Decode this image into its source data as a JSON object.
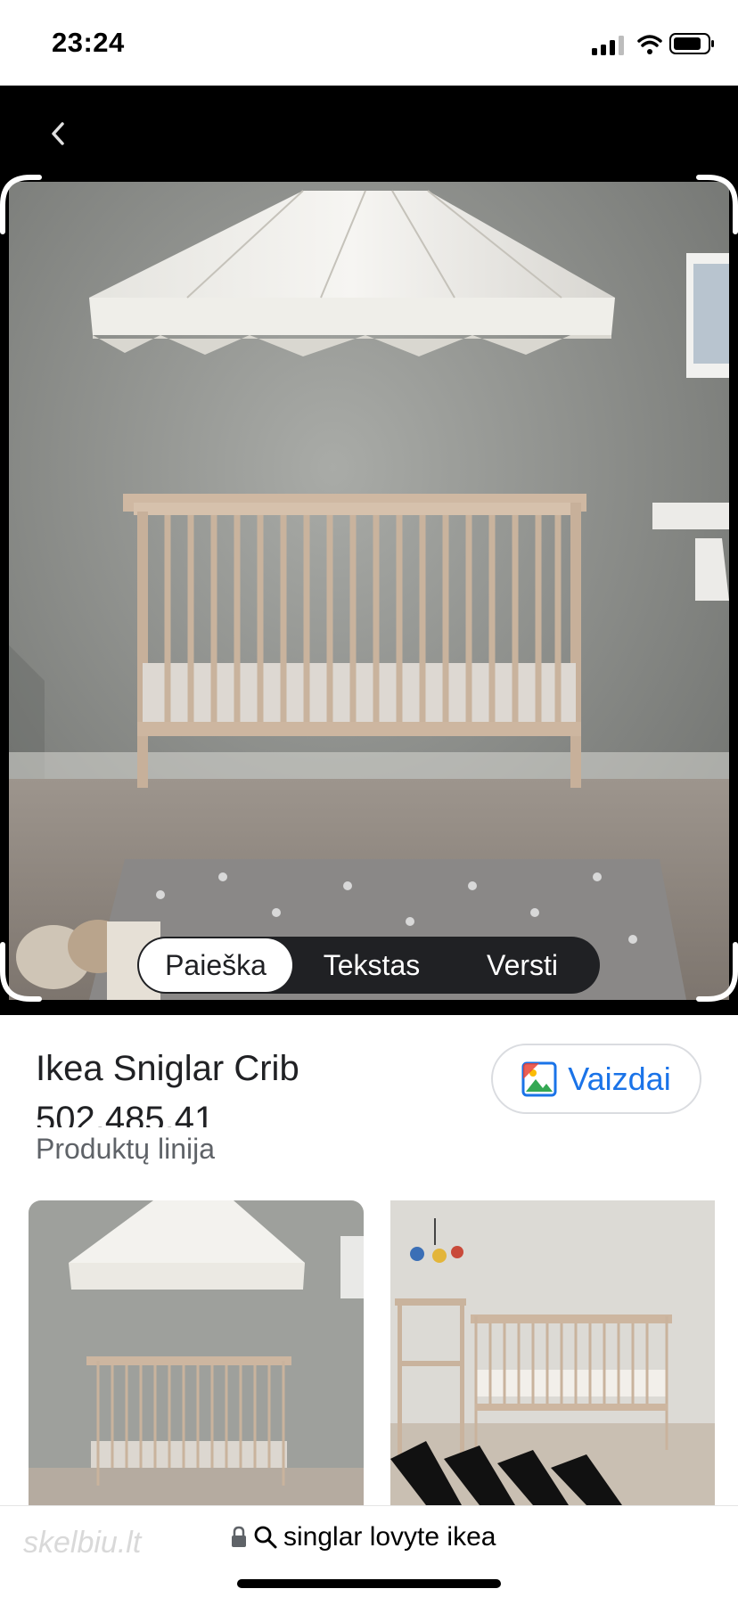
{
  "status_bar": {
    "time": "23:24",
    "icons": [
      "cellular-signal-icon",
      "wifi-icon",
      "battery-icon"
    ]
  },
  "viewer": {
    "back_icon": "chevron-left-icon",
    "tabs": [
      {
        "label": "Paieška",
        "active": true
      },
      {
        "label": "Tekstas",
        "active": false
      },
      {
        "label": "Versti",
        "active": false
      }
    ]
  },
  "result": {
    "title": "Ikea Sniglar Crib",
    "code": "502.485.41",
    "subtitle": "Produktų linija",
    "images_button": {
      "label": "Vaizdai",
      "icon": "image-icon"
    }
  },
  "bottom_bar": {
    "watermark": "skelbiu.lt",
    "lock_icon": "lock-icon",
    "search_icon": "search-icon",
    "query": "singlar lovyte ikea"
  },
  "colors": {
    "accent": "#1a73e8",
    "viewer_background": "#000000",
    "switch_background": "#202124"
  }
}
